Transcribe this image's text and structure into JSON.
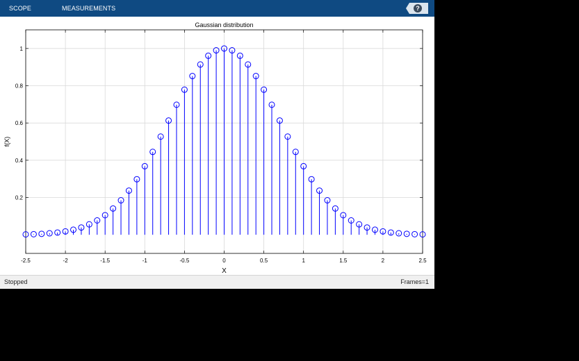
{
  "toolstrip": {
    "tabs": [
      {
        "label": "SCOPE"
      },
      {
        "label": "MEASUREMENTS"
      }
    ],
    "help_label": "?"
  },
  "status": {
    "left": "Stopped",
    "right": "Frames=1"
  },
  "colors": {
    "toolstrip_bg": "#0f4a82",
    "series": "#0000ff"
  },
  "chart_data": {
    "type": "stem",
    "title": "Gaussian distribution",
    "xlabel": "X",
    "ylabel": "f(X)",
    "xlim": [
      -2.5,
      2.5
    ],
    "ylim": [
      -0.1,
      1.1
    ],
    "xticks": [
      -2.5,
      -2,
      -1.5,
      -1,
      -0.5,
      0,
      0.5,
      1,
      1.5,
      2,
      2.5
    ],
    "xtick_labels": [
      "-2.5",
      "-2",
      "-1.5",
      "-1",
      "-0.5",
      "0",
      "0.5",
      "1",
      "1.5",
      "2",
      "2.5"
    ],
    "yticks": [
      0.2,
      0.4,
      0.6,
      0.8,
      1
    ],
    "ytick_labels": [
      "0.2",
      "0.4",
      "0.6",
      "0.8",
      "1"
    ],
    "grid": true,
    "series": [
      {
        "marker": "circle",
        "x": [
          -2.5,
          -2.4,
          -2.3,
          -2.2,
          -2.1,
          -2,
          -1.9,
          -1.8,
          -1.7,
          -1.6,
          -1.5,
          -1.4,
          -1.3,
          -1.2,
          -1.1,
          -1,
          -0.9,
          -0.8,
          -0.7,
          -0.6,
          -0.5,
          -0.4,
          -0.3,
          -0.2,
          -0.1,
          0,
          0.1,
          0.2,
          0.3,
          0.4,
          0.5,
          0.6,
          0.7,
          0.8,
          0.9,
          1,
          1.1,
          1.2,
          1.3,
          1.4,
          1.5,
          1.6,
          1.7,
          1.8,
          1.9,
          2,
          2.1,
          2.2,
          2.3,
          2.4,
          2.5
        ],
        "values": [
          0.002,
          0.003,
          0.005,
          0.008,
          0.012,
          0.018,
          0.027,
          0.039,
          0.056,
          0.077,
          0.105,
          0.141,
          0.185,
          0.237,
          0.298,
          0.368,
          0.445,
          0.527,
          0.613,
          0.698,
          0.779,
          0.852,
          0.914,
          0.961,
          0.99,
          1,
          0.99,
          0.961,
          0.914,
          0.852,
          0.779,
          0.698,
          0.613,
          0.527,
          0.445,
          0.368,
          0.298,
          0.237,
          0.185,
          0.141,
          0.105,
          0.077,
          0.056,
          0.039,
          0.027,
          0.018,
          0.012,
          0.008,
          0.005,
          0.003,
          0.002
        ]
      }
    ]
  }
}
